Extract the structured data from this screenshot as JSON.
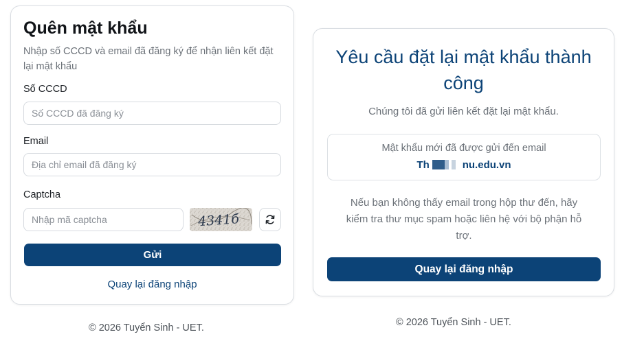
{
  "forgot": {
    "title": "Quên mật khẩu",
    "subtitle": "Nhập số CCCD và email đã đăng ký để nhận liên kết đặt lại mật khẩu",
    "cccd_label": "Số CCCD",
    "cccd_placeholder": "Số CCCD đã đăng ký",
    "email_label": "Email",
    "email_placeholder": "Địa chỉ email đã đăng ký",
    "captcha_label": "Captcha",
    "captcha_placeholder": "Nhập mã captcha",
    "captcha_text": "4341б",
    "submit_label": "Gửi",
    "back_link": "Quay lại đăng nhập",
    "footer": "© 2026 Tuyển Sinh - UET."
  },
  "success": {
    "title": "Yêu cầu đặt lại mật khẩu thành công",
    "desc": "Chúng tôi đã gửi liên kết đặt lại mật khẩu.",
    "email_sent_text": "Mật khẩu mới đã được gửi đến email",
    "email_prefix": "Th",
    "email_suffix": "nu.edu.vn",
    "help": "Nếu bạn không thấy email trong hộp thư đến, hãy kiểm tra thư mục spam hoặc liên hệ với bộ phận hỗ trợ.",
    "back_button": "Quay lại đăng nhập",
    "footer": "© 2026 Tuyển Sinh - UET."
  },
  "colors": {
    "primary": "#0c4377",
    "muted_text": "#6b7178",
    "border": "#d6dadf"
  },
  "icons": {
    "refresh": "refresh-icon"
  }
}
